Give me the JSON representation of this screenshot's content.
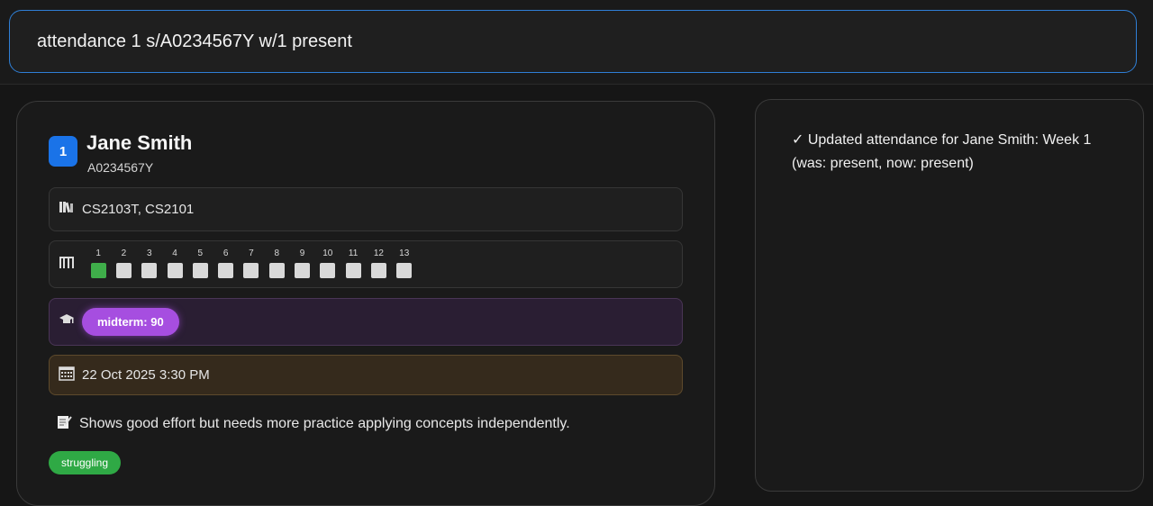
{
  "command": {
    "value": "attendance 1 s/A0234567Y w/1 present"
  },
  "student": {
    "index": "1",
    "name": "Jane Smith",
    "id": "A0234567Y",
    "courses": "CS2103T, CS2101",
    "courses_icon": "books-icon",
    "attendance_icon": "bar-chart-icon",
    "weeks": [
      {
        "label": "1",
        "status": "present"
      },
      {
        "label": "2",
        "status": "none"
      },
      {
        "label": "3",
        "status": "none"
      },
      {
        "label": "4",
        "status": "none"
      },
      {
        "label": "5",
        "status": "none"
      },
      {
        "label": "6",
        "status": "none"
      },
      {
        "label": "7",
        "status": "none"
      },
      {
        "label": "8",
        "status": "none"
      },
      {
        "label": "9",
        "status": "none"
      },
      {
        "label": "10",
        "status": "none"
      },
      {
        "label": "11",
        "status": "none"
      },
      {
        "label": "12",
        "status": "none"
      },
      {
        "label": "13",
        "status": "none"
      }
    ],
    "grades_icon": "graduation-cap-icon",
    "grade": "midterm: 90",
    "session_icon": "calendar-icon",
    "session": "22 Oct 2025 3:30 PM",
    "remark_icon": "memo-icon",
    "remark": "Shows good effort but needs more practice applying concepts independently.",
    "tag": "struggling"
  },
  "result": {
    "message": "✓ Updated attendance for Jane Smith: Week 1 (was: present, now: present)"
  },
  "colors": {
    "accent": "#1a73e8",
    "present": "#3fae4a",
    "grade": "#a64ee0",
    "tag": "#2fa945"
  }
}
